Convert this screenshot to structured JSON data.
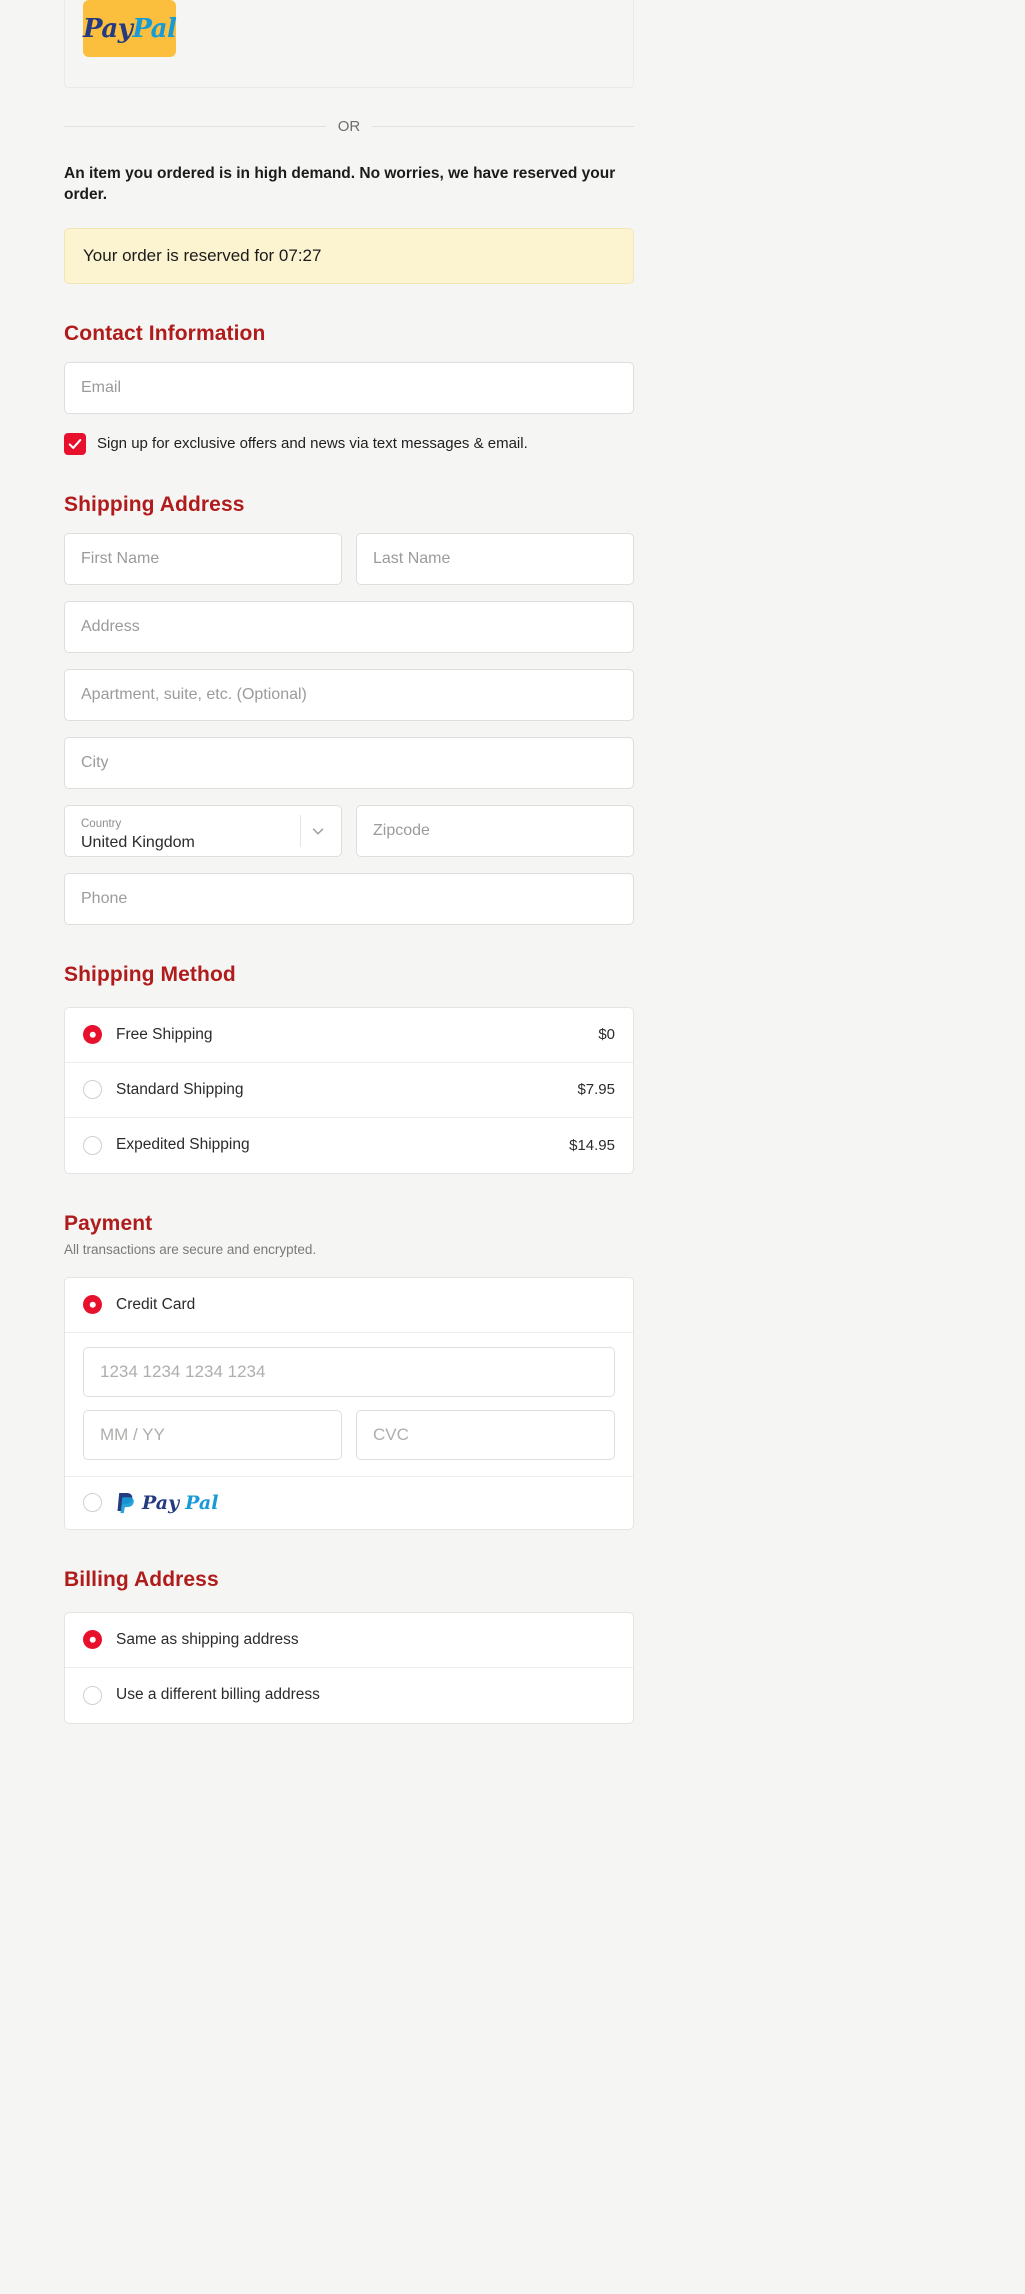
{
  "express": {
    "paypal_button": {
      "pay": "Pay",
      "pal": "Pal"
    }
  },
  "divider": {
    "or": "OR"
  },
  "notice": {
    "text": "An item you ordered is in high demand. No worries, we have reserved your order."
  },
  "reservation": {
    "text": "Your order is reserved for 07:27",
    "timer": "07:27",
    "background": "#fcf3d0"
  },
  "contact": {
    "heading": "Contact Information",
    "email_placeholder": "Email",
    "email_value": "",
    "optin_label": "Sign up for exclusive offers and news via text messages & email.",
    "optin_checked": true
  },
  "shipping_address": {
    "heading": "Shipping Address",
    "first_name_placeholder": "First Name",
    "last_name_placeholder": "Last Name",
    "address_placeholder": "Address",
    "apartment_placeholder": "Apartment, suite, etc. (Optional)",
    "city_placeholder": "City",
    "country_label": "Country",
    "country_value": "United Kingdom",
    "zipcode_placeholder": "Zipcode",
    "phone_placeholder": "Phone"
  },
  "shipping_method": {
    "heading": "Shipping Method",
    "options": [
      {
        "label": "Free Shipping",
        "price": "$0",
        "selected": true
      },
      {
        "label": "Standard Shipping",
        "price": "$7.95",
        "selected": false
      },
      {
        "label": "Expedited Shipping",
        "price": "$14.95",
        "selected": false
      }
    ]
  },
  "payment": {
    "heading": "Payment",
    "subtext": "All transactions are secure and encrypted.",
    "credit_card_label": "Credit Card",
    "credit_card_selected": true,
    "card_number_placeholder": "1234 1234 1234 1234",
    "expiry_placeholder": "MM / YY",
    "cvc_placeholder": "CVC",
    "paypal_label_pay": "Pay",
    "paypal_label_pal": "Pal",
    "paypal_selected": false
  },
  "billing_address": {
    "heading": "Billing Address",
    "options": [
      {
        "label": "Same as shipping address",
        "selected": true
      },
      {
        "label": "Use a different billing address",
        "selected": false
      }
    ]
  },
  "theme": {
    "heading_color": "#b01b1b",
    "accent_red": "#e8112d",
    "paypal_yellow": "#fbbf3d",
    "page_bg": "#f5f5f4"
  }
}
